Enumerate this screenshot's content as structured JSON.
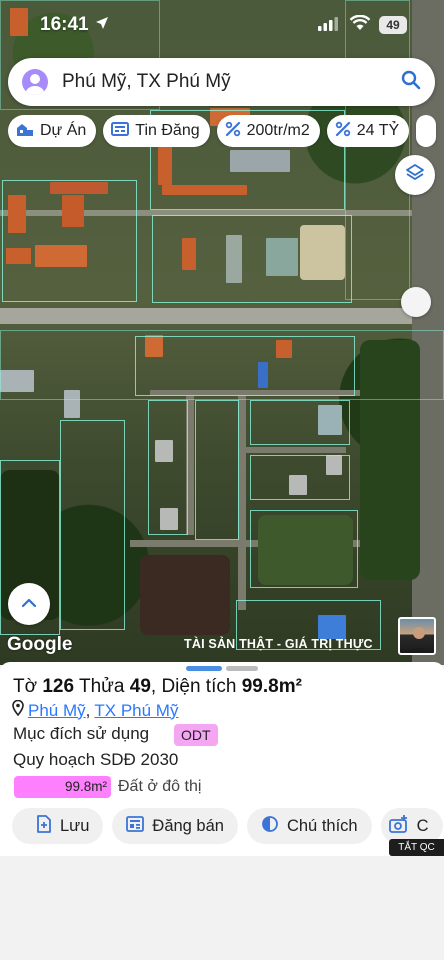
{
  "status_bar": {
    "time": "16:41",
    "battery": "49"
  },
  "search": {
    "query": "Phú Mỹ, TX Phú Mỹ"
  },
  "chips": [
    {
      "icon": "building-icon",
      "label": "Dự Án"
    },
    {
      "icon": "newspaper-icon",
      "label": "Tin Đăng"
    },
    {
      "icon": "percent-icon",
      "label": "200tr/m2"
    },
    {
      "icon": "percent-icon",
      "label": "24 TỶ"
    }
  ],
  "map": {
    "google_label": "Google",
    "watermark": "TÀI SẢN THẬT - GIÁ TRỊ THỰC"
  },
  "parcel": {
    "to_label": "Tờ",
    "to_value": "126",
    "thua_label": "Thửa",
    "thua_value": "49",
    "area_label": "Diện tích",
    "area_value": "99.8m²",
    "ward": "Phú Mỹ",
    "separator": ",",
    "town": "TX Phú Mỹ",
    "purpose_label": "Mục đích sử dụng",
    "purpose_code": "ODT",
    "plan_label": "Quy hoạch SDĐ 2030",
    "legend_value": "99.8m²",
    "legend_text": "Đất ở đô thị",
    "legend_color": "#ff80ff"
  },
  "actions": [
    {
      "icon": "add-doc-icon",
      "label": "Lưu"
    },
    {
      "icon": "list-icon",
      "label": "Đăng bán"
    },
    {
      "icon": "half-circle-icon",
      "label": "Chú thích"
    },
    {
      "icon": "camera-icon",
      "label": "C"
    }
  ],
  "ad_label": "TẮT QC",
  "colors": {
    "accent": "#2979ff",
    "chip_icon": "#3b74d6"
  }
}
